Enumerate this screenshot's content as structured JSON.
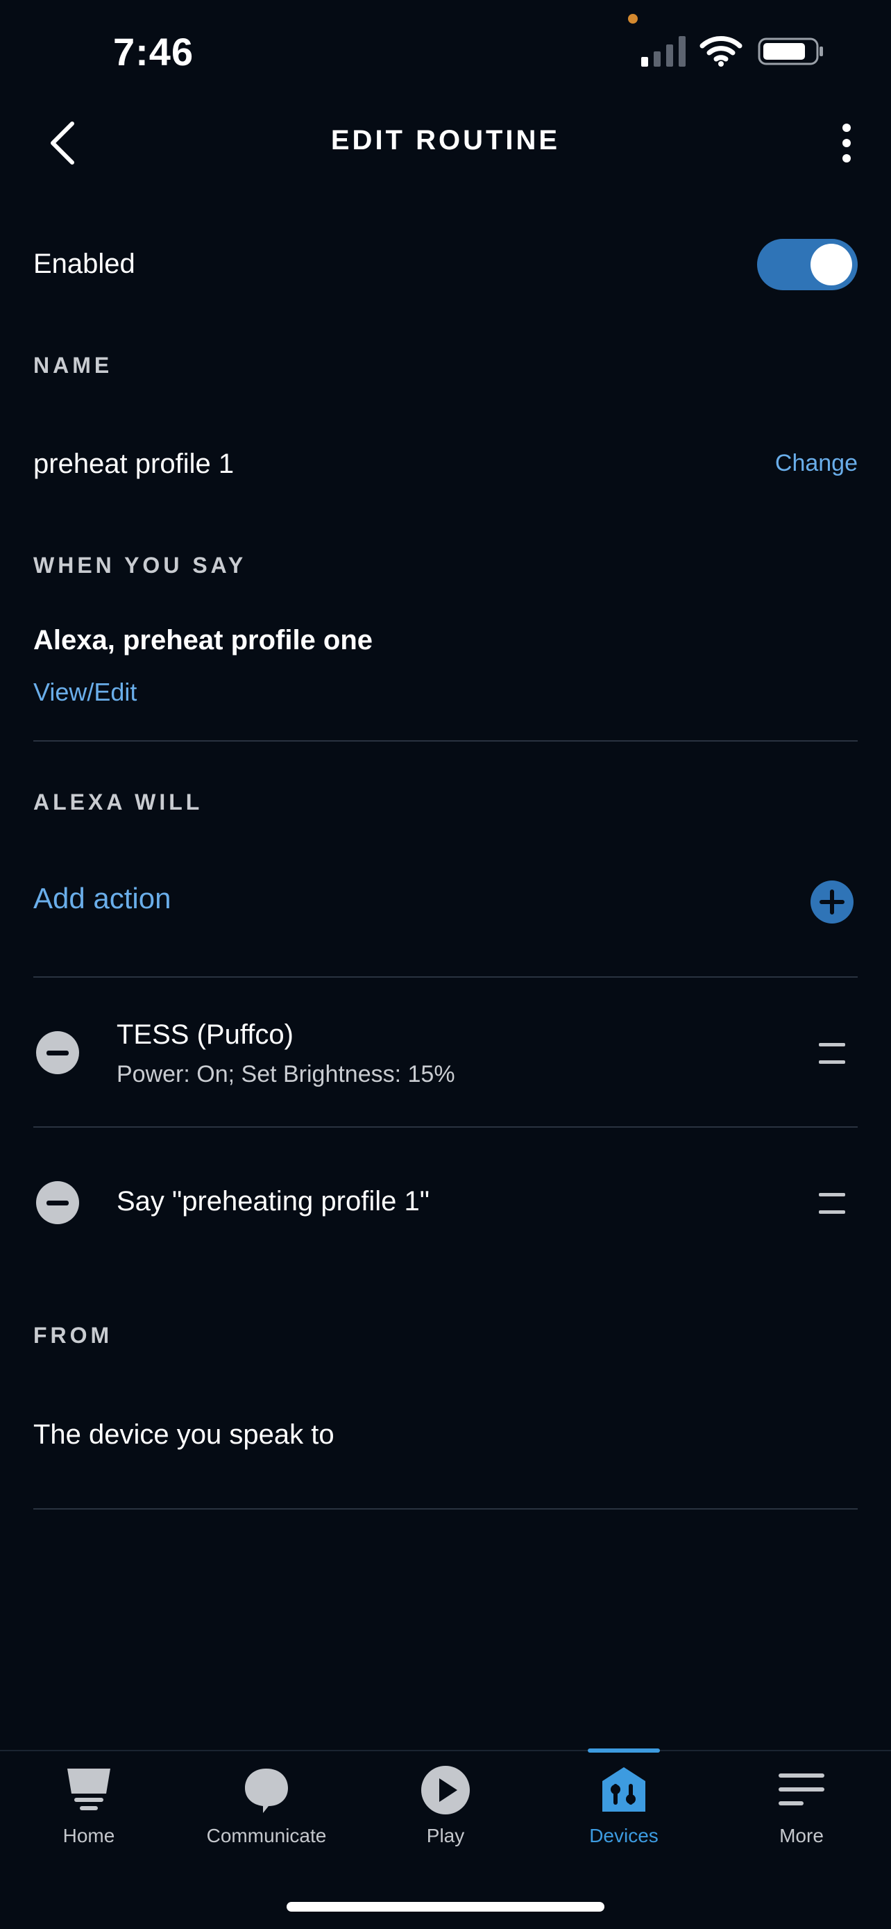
{
  "status_bar": {
    "time": "7:46",
    "icons": [
      "signal-icon",
      "wifi-icon",
      "battery-icon"
    ],
    "privacy_dot_color": "#d4892f"
  },
  "header": {
    "title": "EDIT ROUTINE",
    "back_icon": "chevron-left-icon",
    "more_icon": "more-vertical-icon"
  },
  "enabled": {
    "label": "Enabled",
    "on": true,
    "toggle_color": "#2f74b7"
  },
  "name_section": {
    "header": "NAME",
    "value": "preheat profile 1",
    "change_label": "Change"
  },
  "when_section": {
    "header": "WHEN YOU SAY",
    "phrase": "Alexa, preheat profile one",
    "edit_label": "View/Edit"
  },
  "actions_section": {
    "header": "ALEXA WILL",
    "add_label": "Add action",
    "items": [
      {
        "title": "TESS (Puffco)",
        "subtitle": "Power: On; Set Brightness: 15%"
      },
      {
        "title": "Say \"preheating profile 1\"",
        "subtitle": ""
      }
    ]
  },
  "from_section": {
    "header": "FROM",
    "value": "The device you speak to"
  },
  "bottom_nav": {
    "items": [
      {
        "label": "Home",
        "icon": "home-icon"
      },
      {
        "label": "Communicate",
        "icon": "chat-bubble-icon"
      },
      {
        "label": "Play",
        "icon": "play-icon"
      },
      {
        "label": "Devices",
        "icon": "devices-icon",
        "active": true
      },
      {
        "label": "More",
        "icon": "menu-icon"
      }
    ],
    "active_color": "#3d9be0"
  },
  "colors": {
    "background": "#050b14",
    "link": "#6aaeea",
    "accent": "#2f74b7"
  }
}
